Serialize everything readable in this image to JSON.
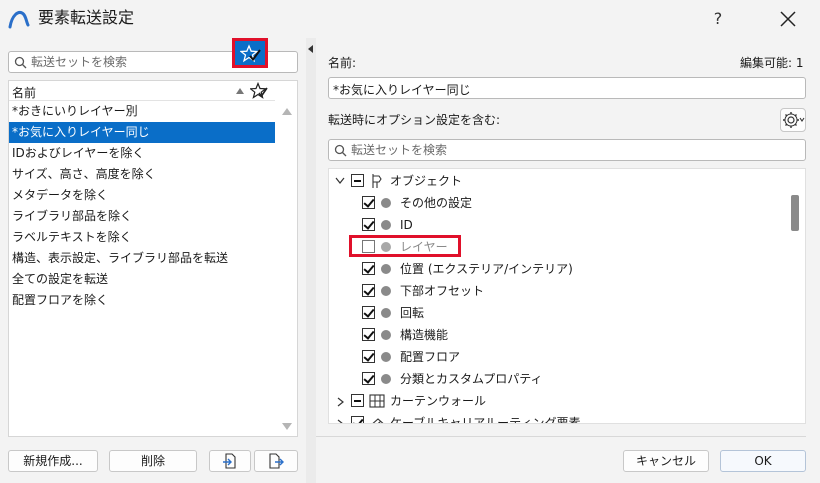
{
  "window": {
    "title": "要素転送設定",
    "help_label": "?"
  },
  "left": {
    "search_placeholder": "転送セットを検索",
    "list_header": "名前",
    "items": [
      "*おきにいりレイヤー別",
      "*お気に入りレイヤー同じ",
      "IDおよびレイヤーを除く",
      "サイズ、高さ、高度を除く",
      "メタデータを除く",
      "ライブラリ部品を除く",
      "ラベルテキストを除く",
      "構造、表示設定、ライブラリ部品を転送",
      "全ての設定を転送",
      "配置フロアを除く"
    ],
    "selected_index": 1,
    "buttons": {
      "new": "新規作成...",
      "delete": "削除"
    }
  },
  "right": {
    "name_label": "名前:",
    "editable_label": "編集可能: 1",
    "name_value": "*お気に入りレイヤー同じ",
    "options_label": "転送時にオプション設定を含む:",
    "search_placeholder": "転送セットを検索",
    "tree": {
      "objects_label": "オブジェクト",
      "rows": [
        {
          "label": "その他の設定",
          "checked": true
        },
        {
          "label": "ID",
          "checked": true
        },
        {
          "label": "レイヤー",
          "checked": false
        },
        {
          "label": "位置 (エクステリア/インテリア)",
          "checked": true
        },
        {
          "label": "下部オフセット",
          "checked": true
        },
        {
          "label": "回転",
          "checked": true
        },
        {
          "label": "構造機能",
          "checked": true
        },
        {
          "label": "配置フロア",
          "checked": true
        },
        {
          "label": "分類とカスタムプロパティ",
          "checked": true
        }
      ],
      "curtain_wall_label": "カーテンウォール",
      "cable_label": "ケーブルキャリアルーティング要素"
    },
    "buttons": {
      "cancel": "キャンセル",
      "ok": "OK"
    }
  },
  "colors": {
    "selection": "#0a6ec8",
    "highlight": "#e0102a"
  }
}
